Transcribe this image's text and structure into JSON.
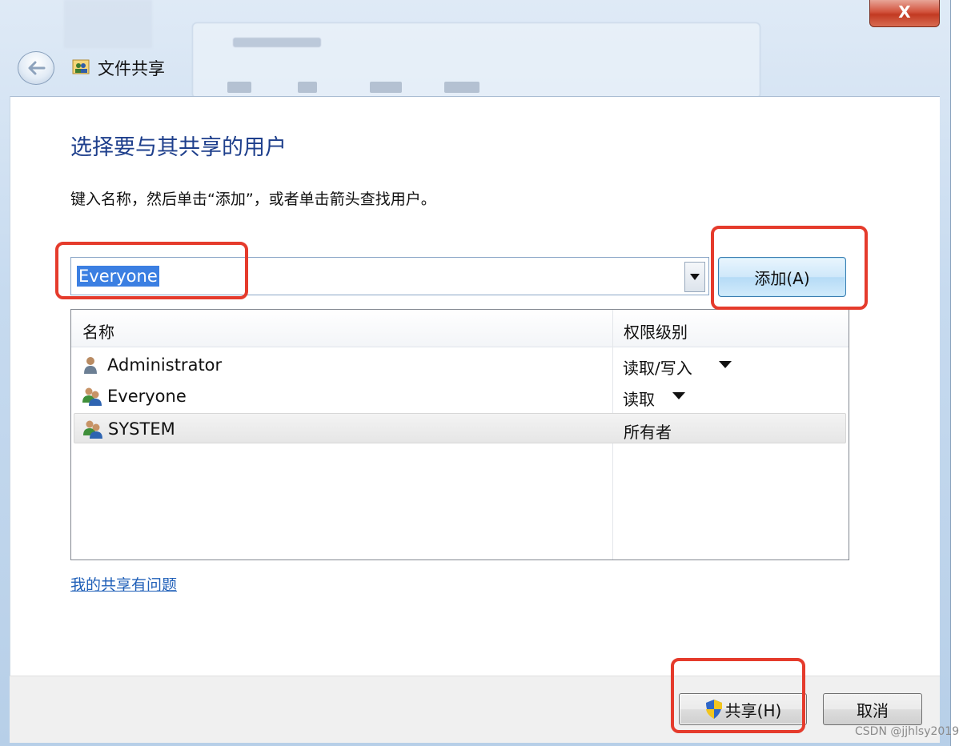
{
  "window": {
    "title": "文件共享",
    "close_label": "X"
  },
  "dialog": {
    "heading": "选择要与其共享的用户",
    "instruction": "键入名称，然后单击“添加”，或者单击箭头查找用户。",
    "input_value": "Everyone",
    "add_button": "添加(A)",
    "columns": {
      "name": "名称",
      "permission": "权限级别"
    },
    "rows": [
      {
        "name": "Administrator",
        "permission": "读取/写入",
        "icon": "single-user-icon"
      },
      {
        "name": "Everyone",
        "permission": "读取",
        "icon": "user-group-icon"
      },
      {
        "name": "SYSTEM",
        "permission": "所有者",
        "icon": "user-group-icon"
      }
    ],
    "help_link": "我的共享有问题",
    "share_button": "共享(H)",
    "cancel_button": "取消"
  },
  "watermark": "CSDN @jjhlsy2019",
  "colors": {
    "heading": "#1e3f8c",
    "link": "#1f5fb8",
    "selection": "#3b7fe2",
    "annotation": "#e53b2c"
  }
}
